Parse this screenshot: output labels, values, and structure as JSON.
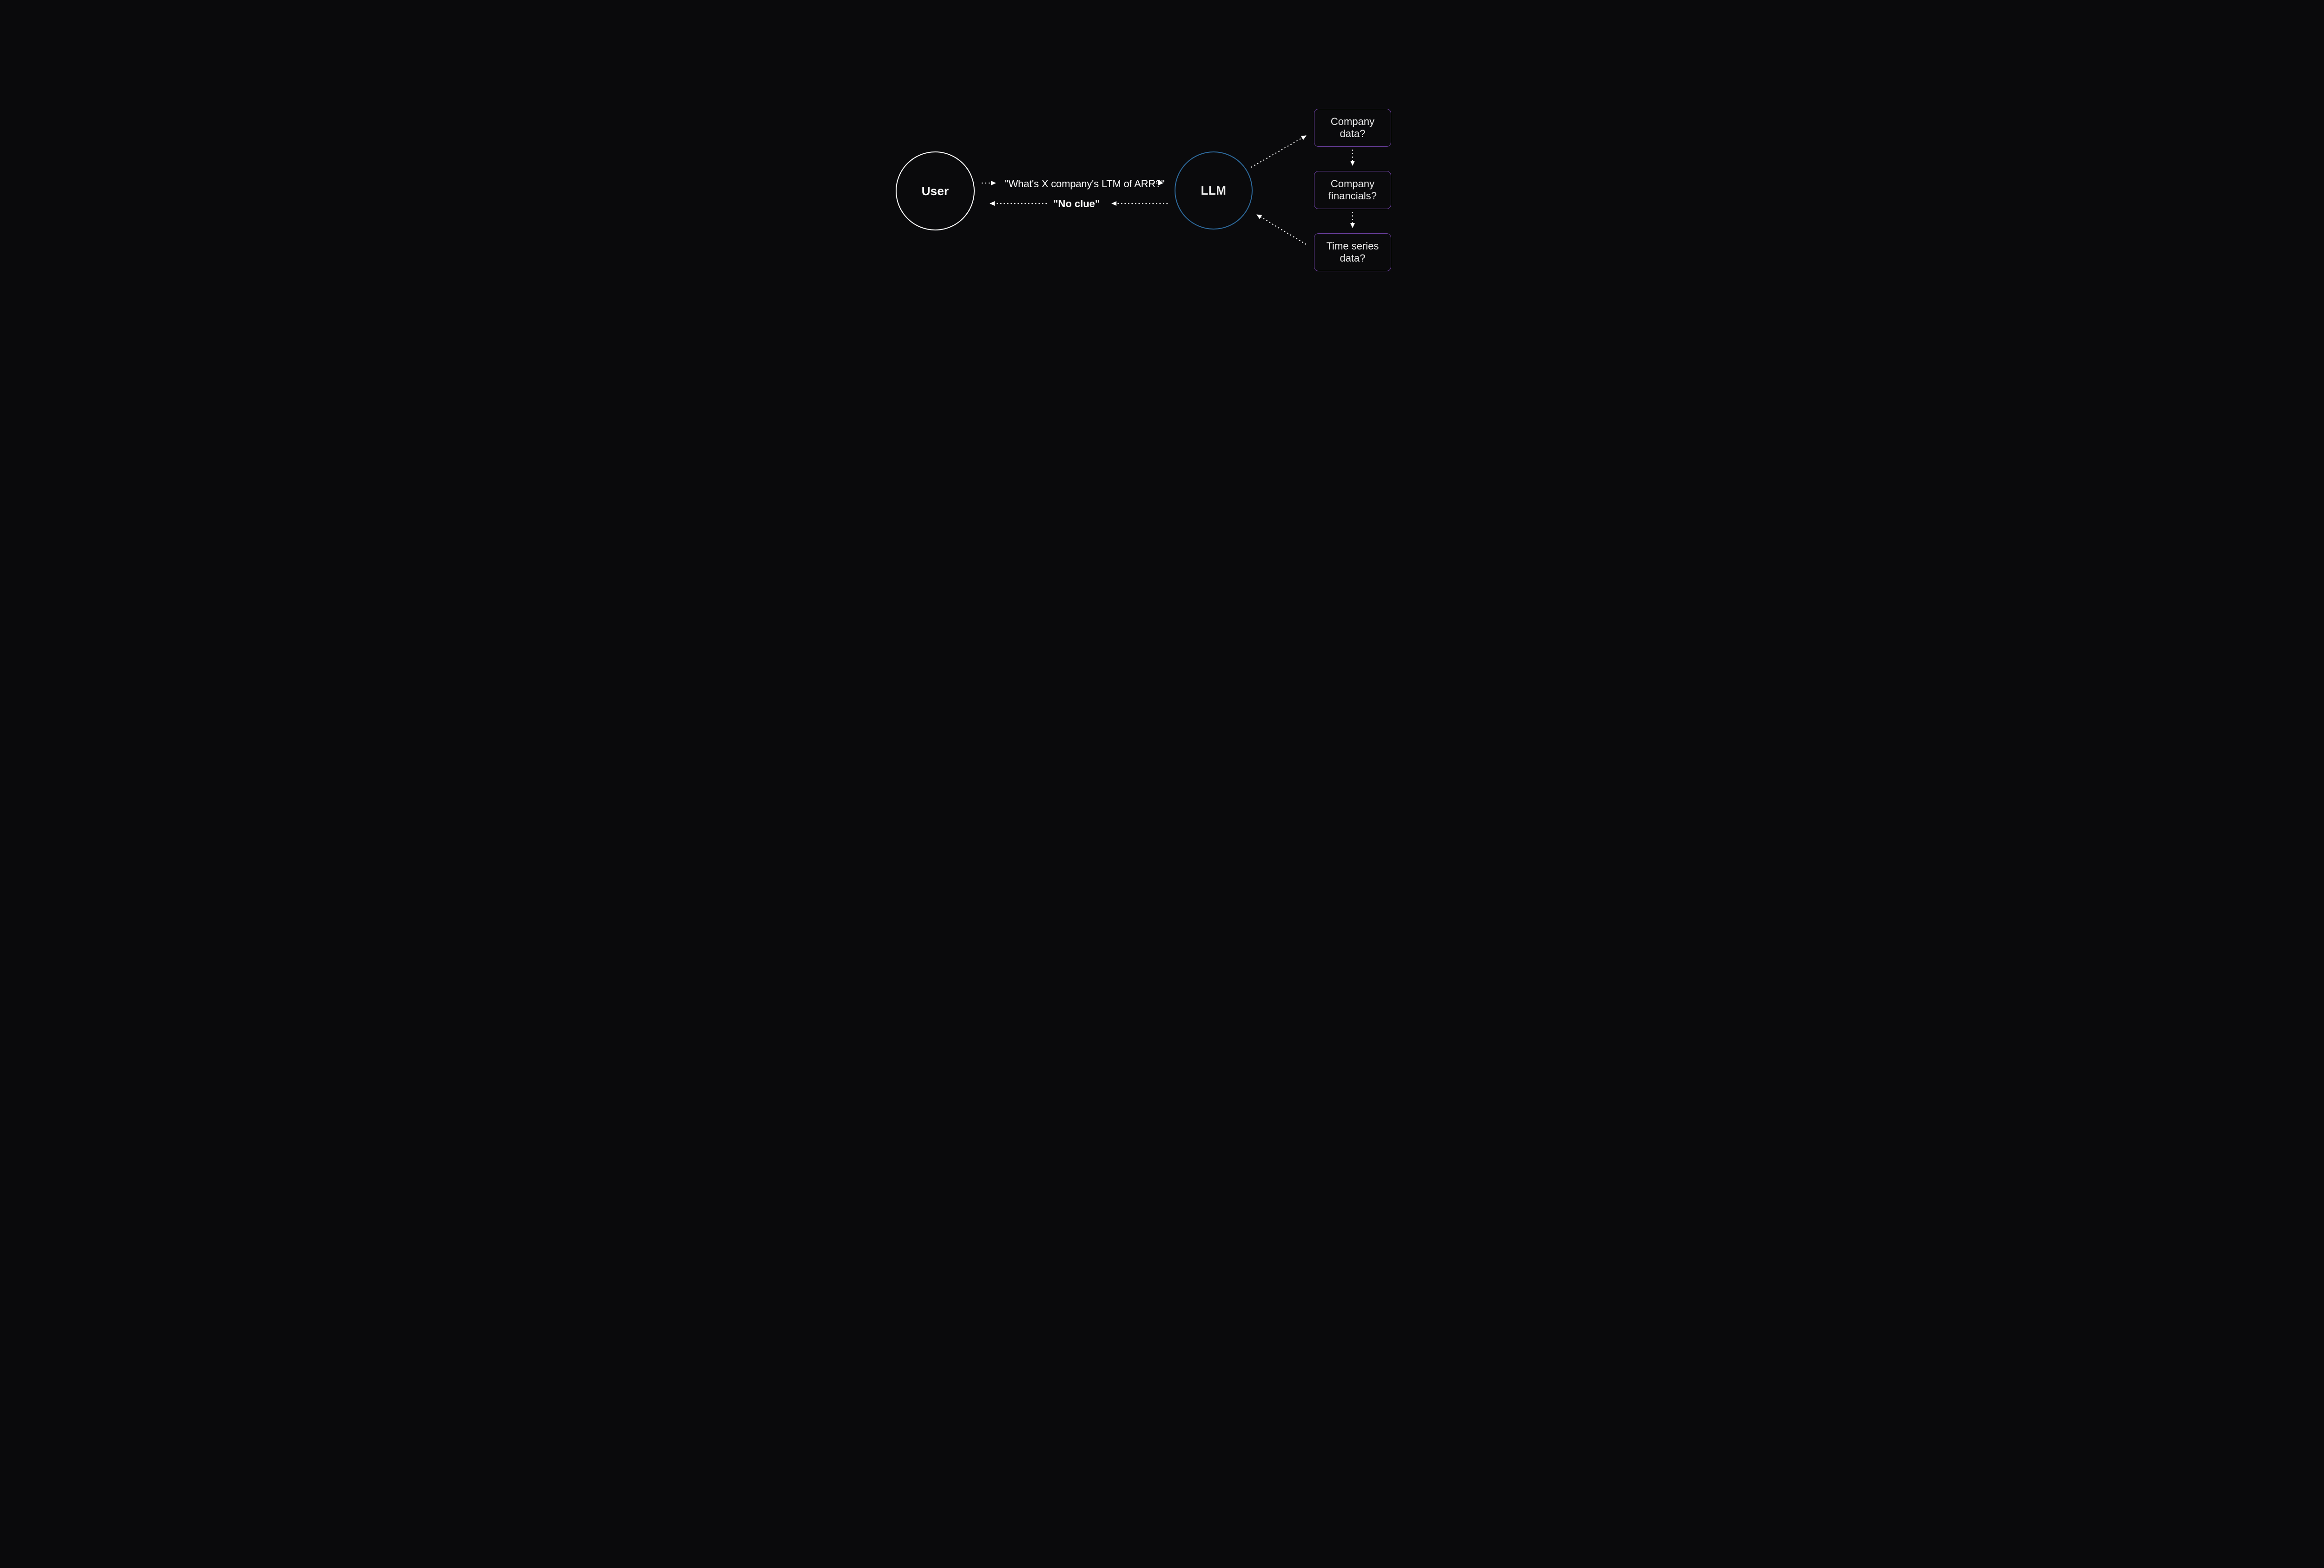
{
  "nodes": {
    "user": {
      "label": "User"
    },
    "llm": {
      "label": "LLM"
    },
    "boxes": [
      {
        "label": "Company data?"
      },
      {
        "label": "Company financials?"
      },
      {
        "label": "Time series data?"
      }
    ]
  },
  "messages": {
    "query": "\"What's X company's LTM of ARR?\"",
    "response": "\"No clue\""
  },
  "colors": {
    "background": "#0a0a0c",
    "userBorder": "#ffffff",
    "llmBorder": "#2e6b9e",
    "boxBorder": "#6b3fa0",
    "text": "#f0f0f0",
    "arrow": "#ffffff"
  }
}
